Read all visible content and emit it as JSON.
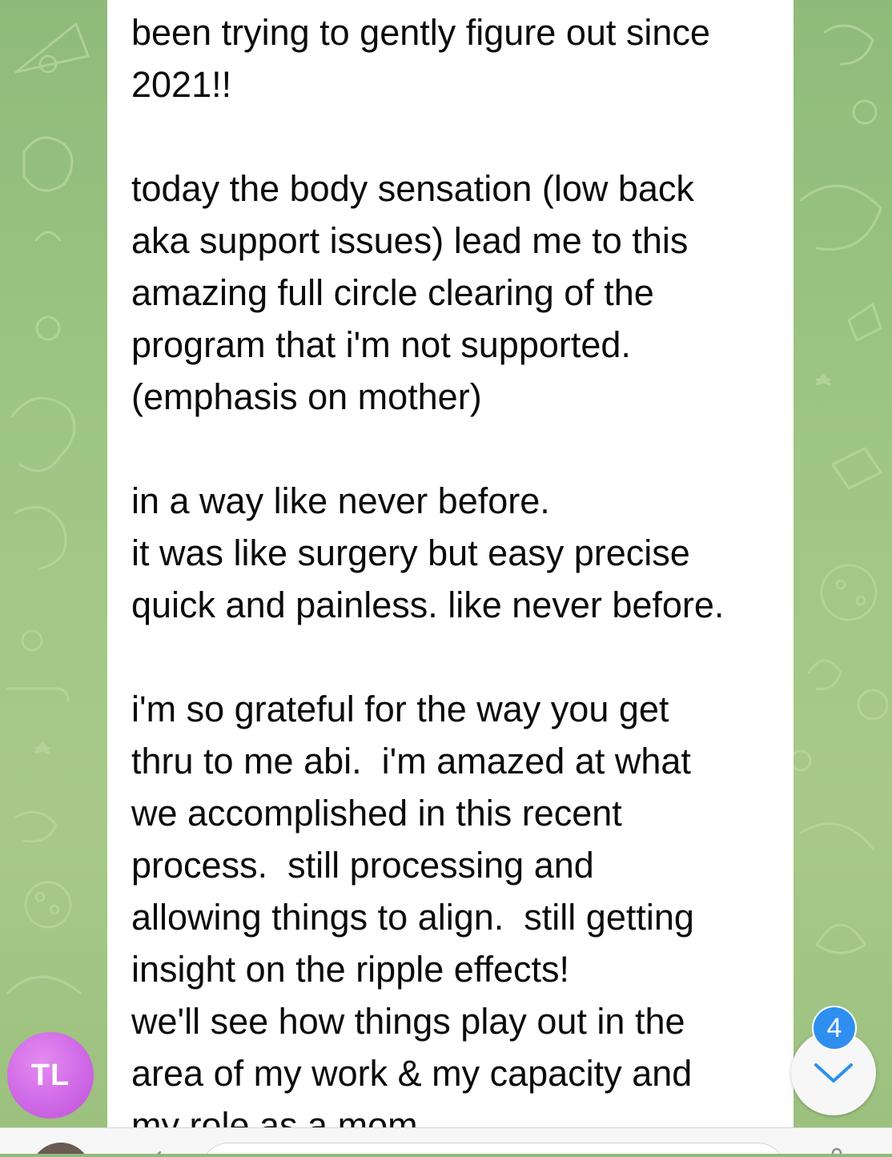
{
  "chat": {
    "message_text": "been trying to gently figure out since\n2021!!\n\ntoday the body sensation (low back\naka support issues) lead me to this\namazing full circle clearing of the\nprogram that i'm not supported.\n(emphasis on mother)\n\nin a way like never before.\nit was like surgery but easy precise\nquick and painless. like never before.\n\ni'm so grateful for the way you get\nthru to me abi.  i'm amazed at what\nwe accomplished in this recent\nprocess.  still processing and\nallowing things to align.  still getting\ninsight on the ripple effects!\nwe'll see how things play out in the\narea of my work & my capacity and\nmy role as a mom"
  },
  "sender": {
    "initials": "TL",
    "avatar_color": "#cf69e6"
  },
  "scroll_down": {
    "icon": "chevron-down-icon",
    "unread_count": "4",
    "badge_color": "#2f8ff0"
  },
  "composer": {
    "avatar_icon": "user-avatar-icon",
    "attach_icon": "attach-icon",
    "mic_icon": "mic-icon"
  },
  "colors": {
    "wallpaper": "#9fc684",
    "bubble": "#ffffff",
    "accent": "#2f8ff0"
  }
}
